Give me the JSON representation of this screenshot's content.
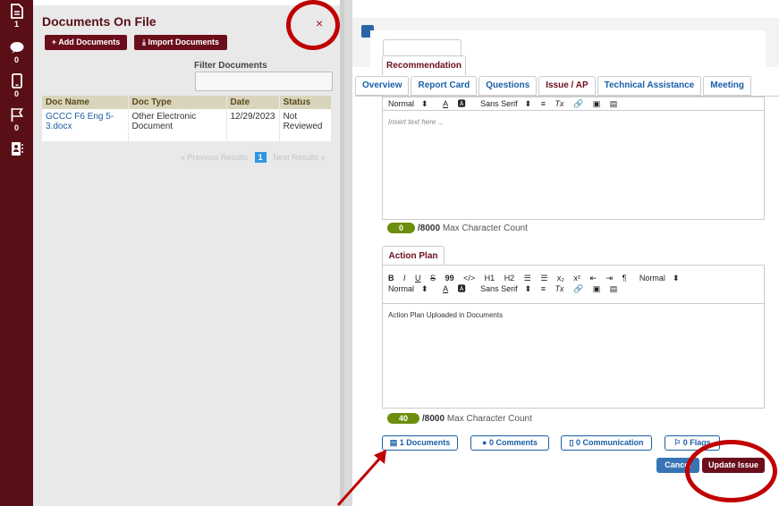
{
  "rail": {
    "items": [
      {
        "icon": "document-icon",
        "count": "1"
      },
      {
        "icon": "comment-icon",
        "count": "0"
      },
      {
        "icon": "mobile-icon",
        "count": "0"
      },
      {
        "icon": "flag-icon",
        "count": "0"
      },
      {
        "icon": "contact-card-icon",
        "count": ""
      }
    ]
  },
  "documents_panel": {
    "title": "Documents On File",
    "add_label": "+ Add Documents",
    "import_label": "Import Documents",
    "filter_label": "Filter Documents",
    "filter_value": "",
    "close_label": "×",
    "columns": [
      "Doc Name",
      "Doc Type",
      "Date",
      "Status"
    ],
    "rows": [
      {
        "name": "GCCC F6 Eng 5-3.docx",
        "type": "Other Electronic Document",
        "date": "12/29/2023",
        "status": "Not Reviewed"
      }
    ],
    "pager": {
      "prev": "« Previous Results",
      "current": "1",
      "next": "Next Results »"
    }
  },
  "issue_form": {
    "recommendation_tab": "Recommendation",
    "tabs": [
      "Overview",
      "Report Card",
      "Questions",
      "Issue / AP",
      "Technical Assistance",
      "Meeting"
    ],
    "active_tab": "Issue / AP",
    "recommendation_editor": {
      "toolbar": [
        "Normal",
        "A",
        "Sans Serif",
        "≡",
        "Tx",
        "link",
        "image",
        "video"
      ],
      "placeholder": "Insert text here ...",
      "count": "0",
      "max_label": "/8000",
      "max_suffix": "Max Character Count"
    },
    "action_plan_tab": "Action Plan",
    "action_plan_editor": {
      "toolbar_row1": [
        "B",
        "I",
        "U",
        "S",
        "99",
        "</>",
        "H1",
        "H2",
        "list-ol",
        "list-ul",
        "x₂",
        "x²",
        "outdent",
        "indent",
        "¶",
        "Normal"
      ],
      "toolbar_row2": [
        "Normal",
        "A",
        "Sans Serif",
        "≡",
        "Tx",
        "link",
        "image",
        "video"
      ],
      "text": "Action Plan Uploaded in Documents",
      "count": "40",
      "max_label": "/8000",
      "max_suffix": "Max Character Count"
    },
    "buttons": {
      "documents": "1 Documents",
      "comments": "0 Comments",
      "communication": "0 Communication",
      "flags": "0 Flags",
      "cancel": "Cancel",
      "update": "Update Issue"
    }
  },
  "colors": {
    "maroon": "#6b0e1c",
    "link_blue": "#1a5fa8",
    "count_green": "#6b8e0e",
    "annotation_red": "#c00000"
  }
}
